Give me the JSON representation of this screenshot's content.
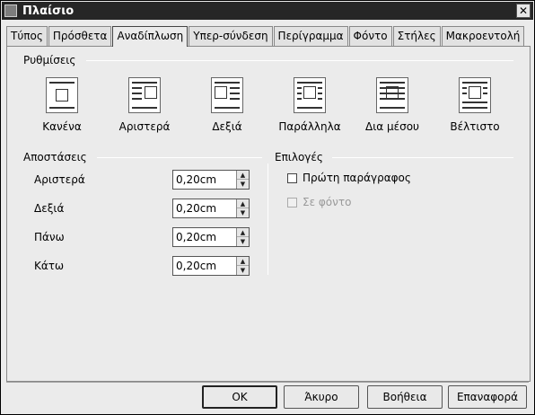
{
  "window": {
    "title": "Πλαίσιο",
    "close_glyph": "✕"
  },
  "tabs": [
    {
      "label": "Τύπος",
      "active": false
    },
    {
      "label": "Πρόσθετα",
      "active": false
    },
    {
      "label": "Αναδίπλωση",
      "active": true
    },
    {
      "label": "Υπερ-σύνδεση",
      "active": false
    },
    {
      "label": "Περίγραμμα",
      "active": false
    },
    {
      "label": "Φόντο",
      "active": false
    },
    {
      "label": "Στήλες",
      "active": false
    },
    {
      "label": "Μακροεντολή",
      "active": false
    }
  ],
  "settings": {
    "heading": "Ρυθμίσεις",
    "options": [
      {
        "label": "Κανένα",
        "icon": "wrap-none-icon"
      },
      {
        "label": "Αριστερά",
        "icon": "wrap-left-icon"
      },
      {
        "label": "Δεξιά",
        "icon": "wrap-right-icon"
      },
      {
        "label": "Παράλληλα",
        "icon": "wrap-parallel-icon"
      },
      {
        "label": "Δια μέσου",
        "icon": "wrap-through-icon"
      },
      {
        "label": "Βέλτιστο",
        "icon": "wrap-optimal-icon"
      }
    ]
  },
  "spacing": {
    "heading": "Αποστάσεις",
    "rows": [
      {
        "label": "Αριστερά",
        "value": "0,20cm"
      },
      {
        "label": "Δεξιά",
        "value": "0,20cm"
      },
      {
        "label": "Πάνω",
        "value": "0,20cm"
      },
      {
        "label": "Κάτω",
        "value": "0,20cm"
      }
    ]
  },
  "options": {
    "heading": "Επιλογές",
    "first_paragraph": {
      "label": "Πρώτη παράγραφος",
      "checked": false,
      "enabled": true
    },
    "in_background": {
      "label": "Σε φόντο",
      "checked": false,
      "enabled": false
    }
  },
  "buttons": {
    "ok": "OK",
    "cancel": "Άκυρο",
    "help": "Βοήθεια",
    "reset": "Επαναφορά"
  }
}
